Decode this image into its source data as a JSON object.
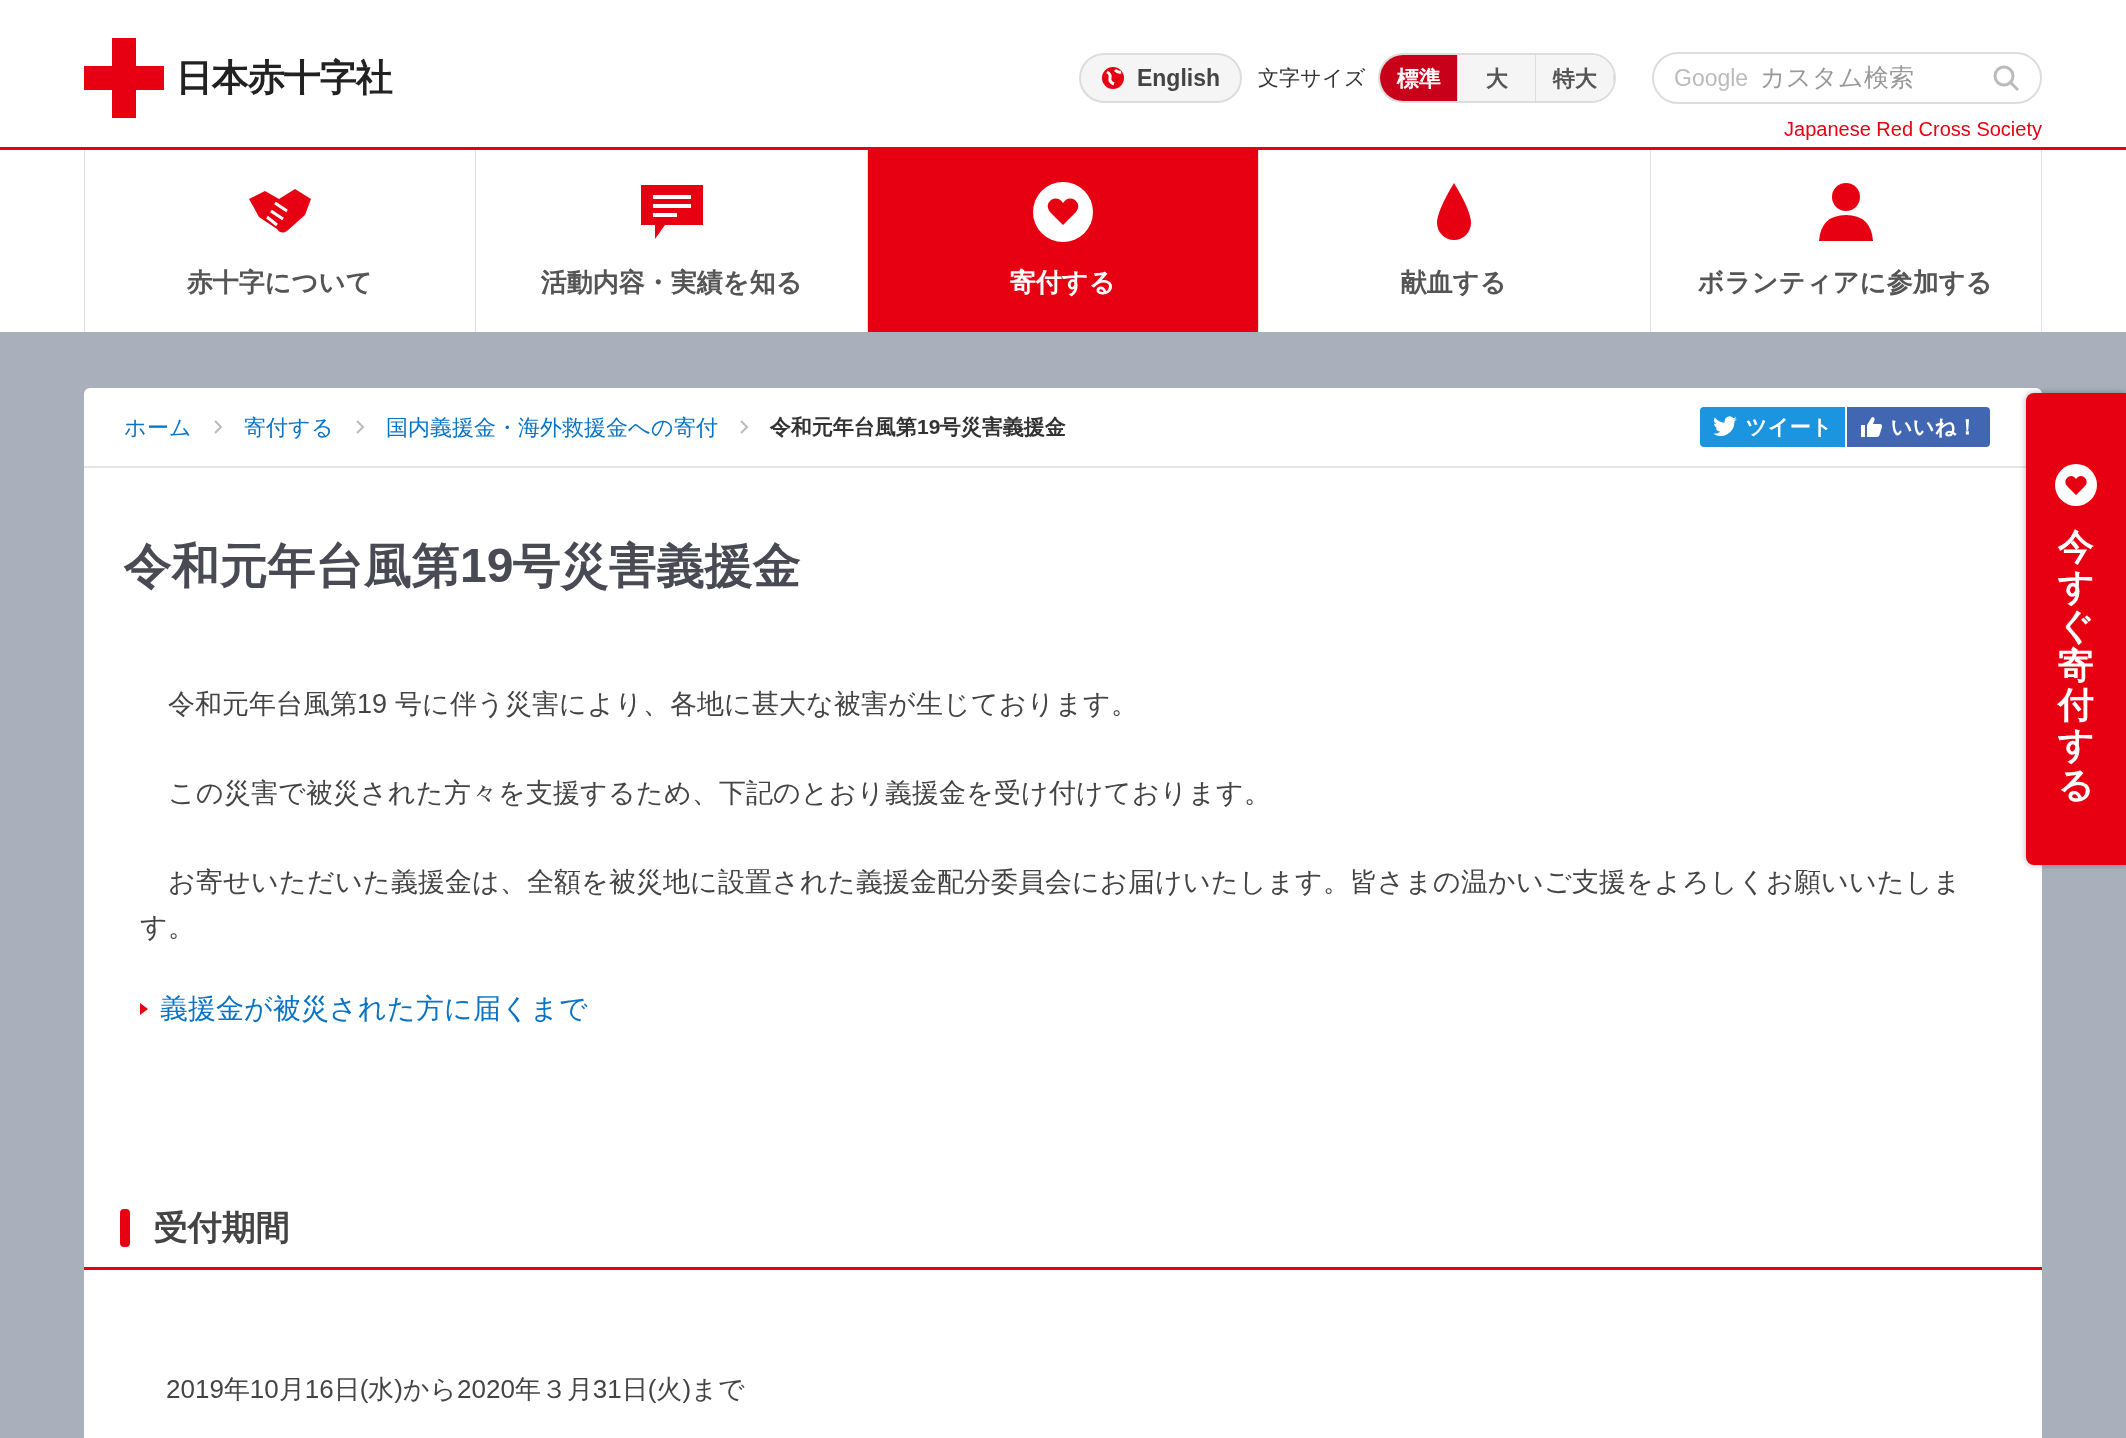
{
  "header": {
    "logo": "日本赤十字社",
    "language_button": "English",
    "font_size_label": "文字サイズ",
    "font_sizes": [
      {
        "label": "標準",
        "selected": true
      },
      {
        "label": "大",
        "selected": false
      },
      {
        "label": "特大",
        "selected": false
      }
    ],
    "search": {
      "brand": "Google",
      "placeholder": "カスタム検索"
    },
    "tagline": "Japanese Red Cross Society"
  },
  "nav": [
    {
      "label": "赤十字について",
      "selected": false
    },
    {
      "label": "活動内容・実績を知る",
      "selected": false
    },
    {
      "label": "寄付する",
      "selected": true
    },
    {
      "label": "献血する",
      "selected": false
    },
    {
      "label": "ボランティアに参加する",
      "selected": false
    }
  ],
  "breadcrumb": [
    {
      "label": "ホーム",
      "kind": "link"
    },
    {
      "label": "寄付する",
      "kind": "link"
    },
    {
      "label": "国内義援金・海外救援金への寄付",
      "kind": "link"
    },
    {
      "label": "令和元年台風第19号災害義援金",
      "kind": "current"
    }
  ],
  "share_buttons": [
    {
      "label": "ツイート",
      "kind": "tweet"
    },
    {
      "label": "いいね！",
      "kind": "like"
    }
  ],
  "side_tab": "今すぐ寄付する",
  "title": "令和元年台風第19号災害義援金",
  "paragraphs": [
    "令和元年台風第19 号に伴う災害により、各地に甚大な被害が生じております。",
    "この災害で被災された方々を支援するため、下記のとおり義援金を受け付けております。",
    "お寄せいただいた義援金は、全額を被災地に設置された義援金配分委員会にお届けいたします。皆さまの温かいご支援をよろしくお願いいたします。"
  ],
  "link": "義援金が被災された方に届くまで",
  "section": {
    "heading": "受付期間",
    "text": "2019年10月16日(水)から2020年３月31日(火)まで"
  }
}
